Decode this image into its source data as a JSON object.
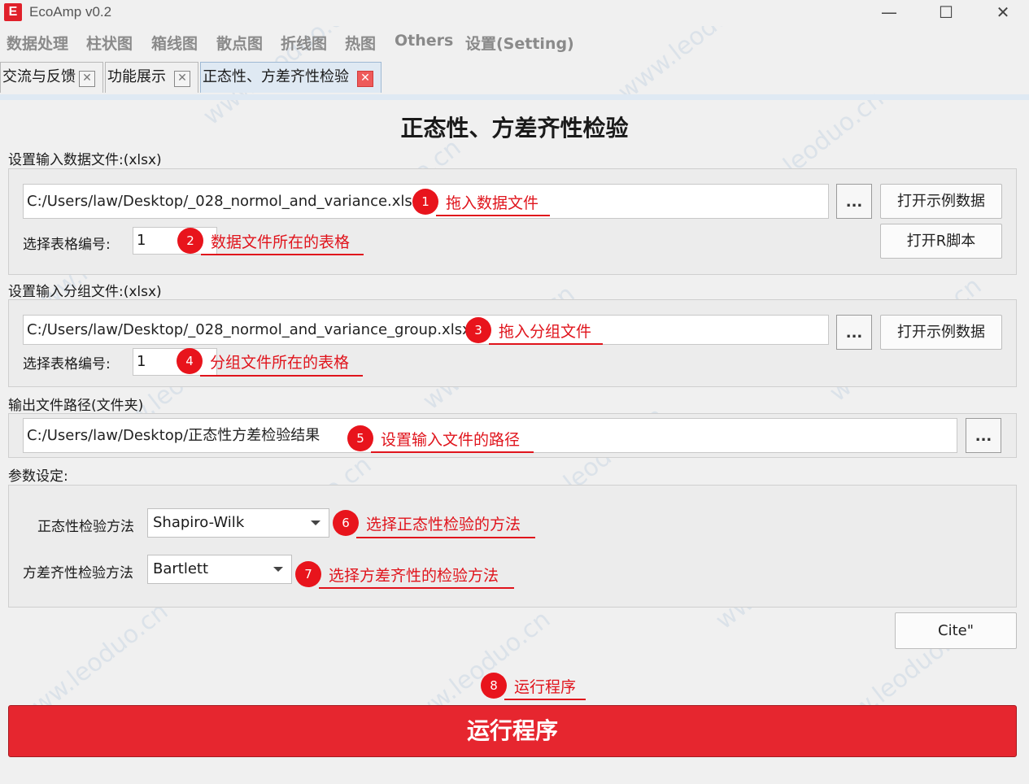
{
  "window": {
    "logo": "E",
    "title": "EcoAmp v0.2",
    "minimize": "—",
    "maximize": "☐",
    "close": "✕"
  },
  "menu": [
    "数据处理",
    "柱状图",
    "箱线图",
    "散点图",
    "折线图",
    "热图",
    "Others",
    "设置(Setting)"
  ],
  "tabs": [
    {
      "label": "交流与反馈",
      "close": "✕"
    },
    {
      "label": "功能展示",
      "close": "✕"
    },
    {
      "label": "正态性、方差齐性检验",
      "close": "✕"
    }
  ],
  "page_title": "正态性、方差齐性检验",
  "data_section": {
    "label": "设置输入数据文件:(xlsx)",
    "path": "C:/Users/law/Desktop/_028_normol_and_variance.xlsx",
    "browse": "...",
    "sheet_label": "选择表格编号:",
    "sheet_value": "1",
    "open_example": "打开示例数据",
    "open_r": "打开R脚本"
  },
  "group_section": {
    "label": "设置输入分组文件:(xlsx)",
    "path": "C:/Users/law/Desktop/_028_normol_and_variance_group.xlsx",
    "browse": "...",
    "sheet_label": "选择表格编号:",
    "sheet_value": "1",
    "open_example": "打开示例数据"
  },
  "output_section": {
    "label": "输出文件路径(文件夹)",
    "path": "C:/Users/law/Desktop/正态性方差检验结果",
    "browse": "..."
  },
  "params": {
    "label": "参数设定:",
    "normality_label": "正态性检验方法",
    "normality_value": "Shapiro-Wilk",
    "variance_label": "方差齐性检验方法",
    "variance_value": "Bartlett"
  },
  "cite": "Cite\"",
  "run_button": "运行程序",
  "annotations": [
    {
      "n": "1",
      "text": "拖入数据文件"
    },
    {
      "n": "2",
      "text": "数据文件所在的表格"
    },
    {
      "n": "3",
      "text": "拖入分组文件"
    },
    {
      "n": "4",
      "text": "分组文件所在的表格"
    },
    {
      "n": "5",
      "text": "设置输入文件的路径"
    },
    {
      "n": "6",
      "text": "选择正态性检验的方法"
    },
    {
      "n": "7",
      "text": "选择方差齐性的检验方法"
    },
    {
      "n": "8",
      "text": "运行程序"
    }
  ],
  "watermark": "www.leoduo.cn",
  "colors": {
    "accent_red": "#e6262f",
    "annotation_red": "#e0141c",
    "active_tab": "#dfe9f3"
  }
}
